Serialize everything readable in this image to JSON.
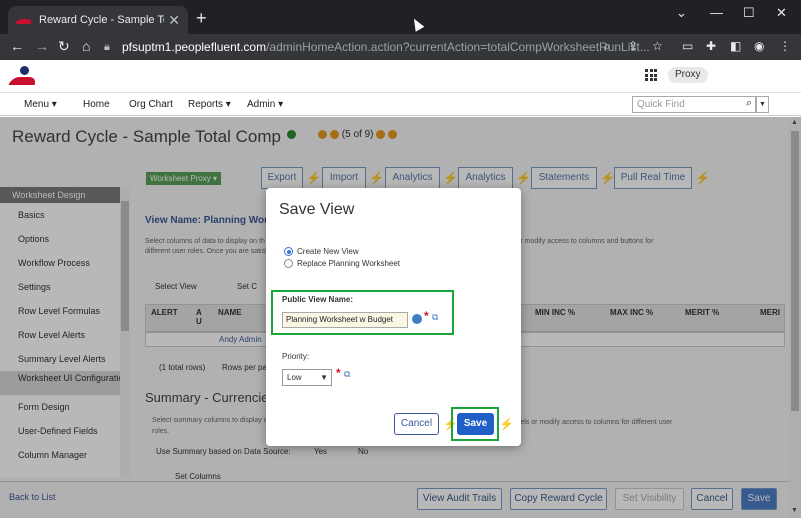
{
  "browser": {
    "tab_title": "Reward Cycle - Sample Total Com",
    "new_tab": "+",
    "url_host": "pfsuptm1.peoplefluent.com",
    "url_path": "/adminHomeAction.action?currentAction=totalCompWorksheetRunList..."
  },
  "header": {
    "proxy": "Proxy"
  },
  "menu": {
    "items": [
      "Menu ▾",
      "Home",
      "Org Chart",
      "Reports ▾",
      "Admin ▾"
    ],
    "quick_find_placeholder": "Quick Find"
  },
  "page": {
    "title": "Reward Cycle - Sample Total Comp",
    "pager": "(5 of 9)",
    "proxy_tag": "Worksheet Proxy ▾",
    "toolbar": [
      "Export",
      "Import",
      "Analytics",
      "Analytics",
      "Statements",
      "Pull Real Time"
    ],
    "view_name_label": "View Name: Planning Worksh",
    "desc_left": "Select columns of data to display on th",
    "desc_left2": "different user roles. Once you are satisf",
    "desc_right": "s or modify access to columns and buttons for",
    "select_view": "Select View",
    "set_col": "Set C",
    "grid_headers": [
      "ALERT",
      "A U",
      "NAME",
      "MIN INC %",
      "MAX INC %",
      "MERIT %",
      "MERI"
    ],
    "grid_row_name": "Andy Admin",
    "total_rows": "(1 total rows)",
    "rows_per": "Rows per pa",
    "section2_title": "Summary - Currencies i",
    "summary_desc": "Select summary columns to display o",
    "summary_desc2": "roles.",
    "summary_desc_right": "labels or modify access to columns for different user",
    "use_summary": "Use Summary based on Data Source:",
    "yes": "Yes",
    "no": "No",
    "set_columns": "Set Columns"
  },
  "sidebar": {
    "header": "Worksheet Design",
    "items": [
      "Basics",
      "Options",
      "Workflow Process",
      "Settings",
      "Row Level Formulas",
      "Row Level Alerts",
      "Summary Level Alerts",
      "Worksheet UI Configuration",
      "Form Design",
      "User-Defined Fields",
      "Column Manager"
    ]
  },
  "bottom": {
    "back": "Back to List",
    "buttons": [
      "View Audit Trails",
      "Copy Reward Cycle",
      "Set Visibility",
      "Cancel",
      "Save"
    ]
  },
  "modal": {
    "title": "Save View",
    "radio_new": "Create New View",
    "radio_replace": "Replace Planning Worksheet",
    "public_view_label": "Public View Name:",
    "public_view_value": "Planning Worksheet w Budget",
    "priority_label": "Priority:",
    "priority_value": "Low",
    "cancel": "Cancel",
    "save": "Save"
  },
  "colors": {
    "highlight": "#1aa53a",
    "save_button": "#1f5fc7",
    "required": "#d2122e"
  }
}
